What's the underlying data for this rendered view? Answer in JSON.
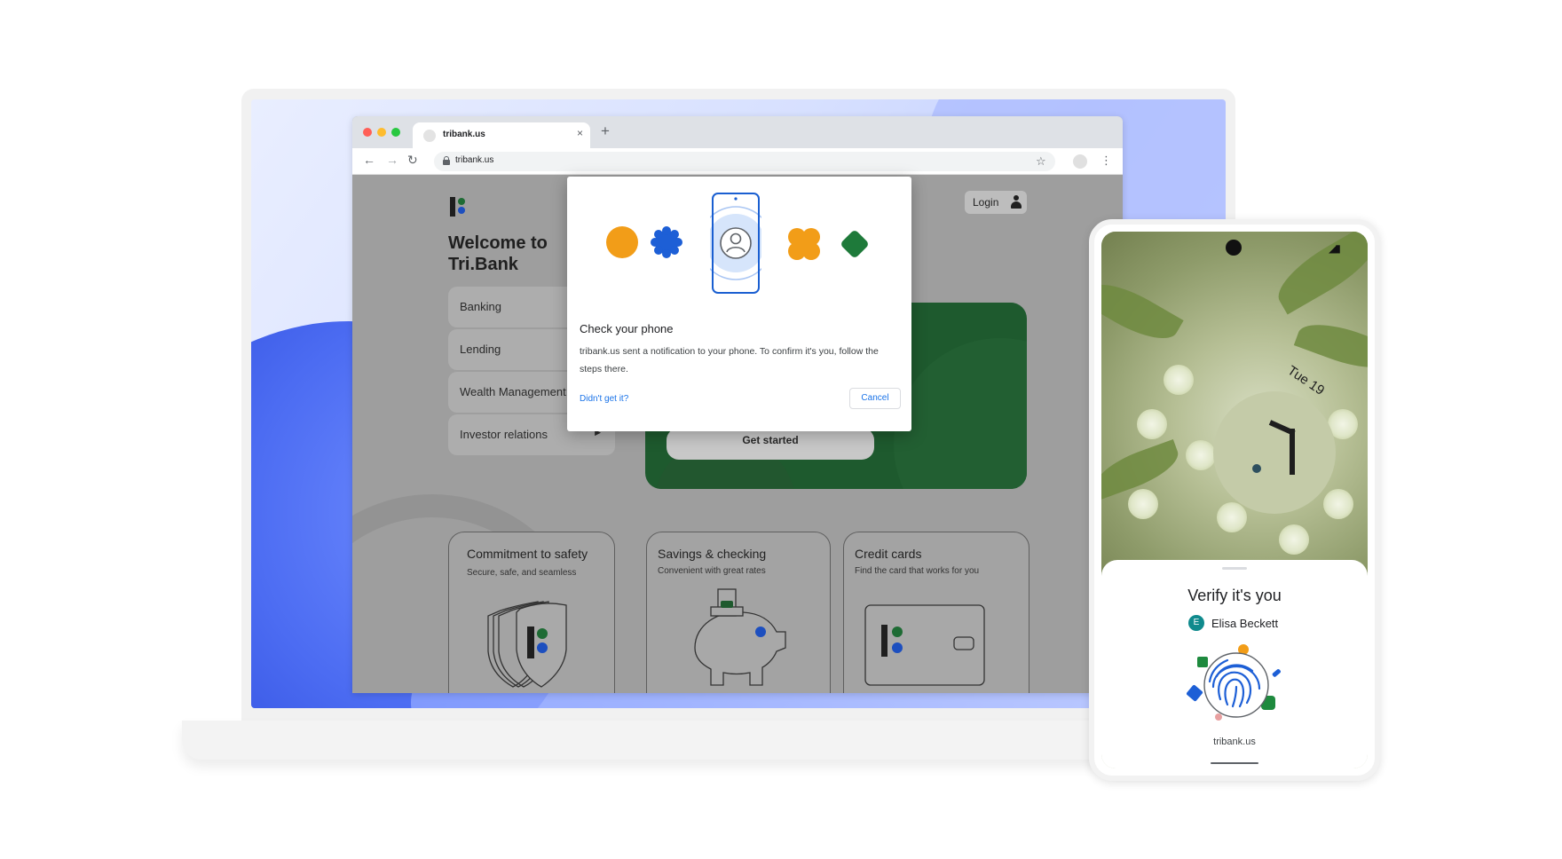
{
  "browser": {
    "tab_title": "tribank.us",
    "tab_close": "×",
    "new_tab": "+",
    "nav": {
      "back": "←",
      "forward": "→",
      "reload": "↻"
    },
    "url": "tribank.us",
    "star": "☆",
    "menu": "⋮"
  },
  "site": {
    "welcome": "Welcome to Tri.Bank",
    "login_label": "Login",
    "menu_items": [
      {
        "label": "Banking"
      },
      {
        "label": "Lending"
      },
      {
        "label": "Wealth Management"
      },
      {
        "label": "Investor relations",
        "caret": "▶"
      }
    ],
    "hero_button": "Get started",
    "cards": [
      {
        "title": "Commitment to safety",
        "subtitle": "Secure, safe, and seamless"
      },
      {
        "title": "Savings & checking",
        "subtitle": "Convenient with great rates"
      },
      {
        "title": "Credit cards",
        "subtitle": "Find the card that works for you"
      }
    ]
  },
  "dialog": {
    "title": "Check your phone",
    "body": "tribank.us sent a notification to your phone. To confirm it's you, follow the steps there.",
    "link": "Didn't get it?",
    "cancel": "Cancel"
  },
  "phone": {
    "date": "Tue 19",
    "status": "◢▮",
    "verify_title": "Verify it's you",
    "account_initial": "E",
    "account_name": "Elisa Beckett",
    "site": "tribank.us"
  },
  "colors": {
    "brand_green": "#1e5a2e",
    "brand_blue": "#1d4fbf",
    "accent_orange": "#f29d18",
    "link_blue": "#1a73e8",
    "avatar_teal": "#0f8a8d"
  }
}
